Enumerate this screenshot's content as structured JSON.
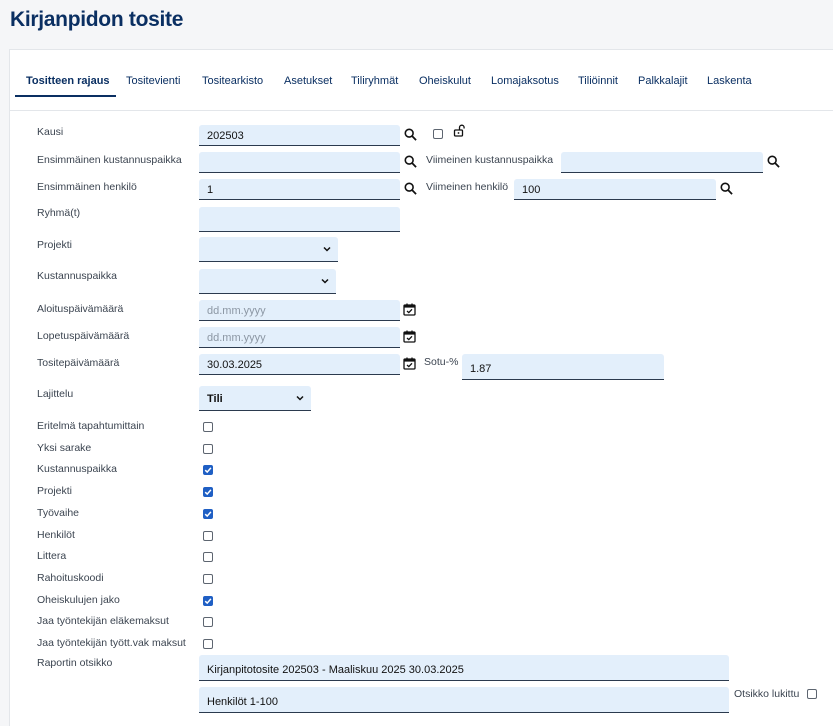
{
  "page": {
    "title": "Kirjanpidon tosite"
  },
  "tabs": [
    {
      "label": "Tositteen rajaus",
      "active": true
    },
    {
      "label": "Tositevienti"
    },
    {
      "label": "Tositearkisto"
    },
    {
      "label": "Asetukset"
    },
    {
      "label": "Tiliryhmät"
    },
    {
      "label": "Oheiskulut"
    },
    {
      "label": "Lomajaksotus"
    },
    {
      "label": "Tiliöinnit"
    },
    {
      "label": "Palkkalajit"
    },
    {
      "label": "Laskenta"
    }
  ],
  "form": {
    "kausi": {
      "label": "Kausi",
      "value": "202503"
    },
    "first_cost_center": {
      "label": "Ensimmäinen kustannuspaikka",
      "value": ""
    },
    "last_cost_center": {
      "label": "Viimeinen kustannuspaikka",
      "value": ""
    },
    "first_person": {
      "label": "Ensimmäinen henkilö",
      "value": "1"
    },
    "last_person": {
      "label": "Viimeinen henkilö",
      "value": "100"
    },
    "groups": {
      "label": "Ryhmä(t)",
      "value": ""
    },
    "project": {
      "label": "Projekti",
      "value": ""
    },
    "cost_center": {
      "label": "Kustannuspaikka",
      "value": ""
    },
    "start_date": {
      "label": "Aloituspäivämäärä",
      "placeholder": "dd.mm.yyyy",
      "value": ""
    },
    "end_date": {
      "label": "Lopetuspäivämäärä",
      "placeholder": "dd.mm.yyyy",
      "value": ""
    },
    "voucher_date": {
      "label": "Tositepäivämäärä",
      "value": "30.03.2025"
    },
    "sotu": {
      "label": "Sotu-%",
      "value": "1.87"
    },
    "sorting": {
      "label": "Lajittelu",
      "value": "Tili"
    },
    "report_title": {
      "label": "Raportin otsikko",
      "line1": "Kirjanpitotosite 202503 - Maaliskuu 2025 30.03.2025",
      "line2": "Henkilöt 1-100"
    },
    "title_locked": {
      "label": "Otsikko lukittu",
      "checked": false
    }
  },
  "checkboxes": [
    {
      "label": "Eritelmä tapahtumittain",
      "checked": false
    },
    {
      "label": "Yksi sarake",
      "checked": false
    },
    {
      "label": "Kustannuspaikka",
      "checked": true
    },
    {
      "label": "Projekti",
      "checked": true
    },
    {
      "label": "Työvaihe",
      "checked": true
    },
    {
      "label": "Henkilöt",
      "checked": false
    },
    {
      "label": "Littera",
      "checked": false
    },
    {
      "label": "Rahoituskoodi",
      "checked": false
    },
    {
      "label": "Oheiskulujen jako",
      "checked": true
    },
    {
      "label": "Jaa työntekijän eläkemaksut",
      "checked": false
    },
    {
      "label": "Jaa työntekijän tyött.vak maksut",
      "checked": false
    }
  ],
  "colors": {
    "accent": "#0a2f62",
    "input_bg": "#e3effb",
    "checkbox_checked": "#1f5fc4"
  }
}
